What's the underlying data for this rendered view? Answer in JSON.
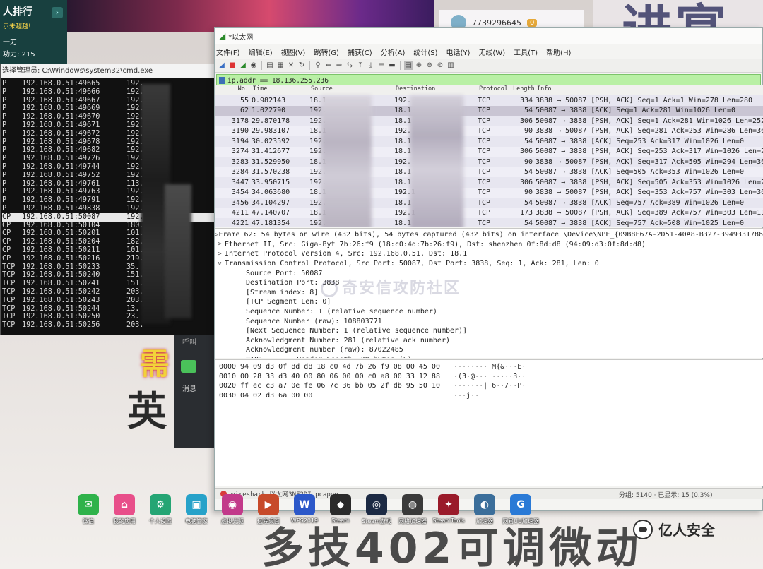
{
  "background": {
    "rank_panel": {
      "title": "人排行",
      "subtitle": "示未超越!",
      "name": "一刀",
      "score": "功力: 215"
    },
    "user_card": {
      "id": "7739296645",
      "level": "0"
    },
    "big_text_top": "进宴",
    "big_text_bottom": "多技402可调微动",
    "banner_chars": [
      "需",
      "英"
    ]
  },
  "side_chat": {
    "label_call": "呼叫",
    "label_message": "消息"
  },
  "cmd": {
    "title": "选择管理员: C:\\Windows\\system32\\cmd.exe",
    "rows": [
      {
        "proto": "P",
        "addr": "192.168.0.51:49665",
        "foreign": "192."
      },
      {
        "proto": "P",
        "addr": "192.168.0.51:49666",
        "foreign": "192."
      },
      {
        "proto": "P",
        "addr": "192.168.0.51:49667",
        "foreign": "192."
      },
      {
        "proto": "P",
        "addr": "192.168.0.51:49669",
        "foreign": "192."
      },
      {
        "proto": "P",
        "addr": "192.168.0.51:49670",
        "foreign": "192."
      },
      {
        "proto": "P",
        "addr": "192.168.0.51:49671",
        "foreign": "192."
      },
      {
        "proto": "P",
        "addr": "192.168.0.51:49672",
        "foreign": "192."
      },
      {
        "proto": "P",
        "addr": "192.168.0.51:49678",
        "foreign": "192."
      },
      {
        "proto": "P",
        "addr": "192.168.0.51:49682",
        "foreign": "192."
      },
      {
        "proto": "P",
        "addr": "192.168.0.51:49726",
        "foreign": "192."
      },
      {
        "proto": "P",
        "addr": "192.168.0.51:49744",
        "foreign": "192."
      },
      {
        "proto": "P",
        "addr": "192.168.0.51:49752",
        "foreign": "192."
      },
      {
        "proto": "P",
        "addr": "192.168.0.51:49761",
        "foreign": "113."
      },
      {
        "proto": "P",
        "addr": "192.168.0.51:49763",
        "foreign": "192."
      },
      {
        "proto": "P",
        "addr": "192.168.0.51:49791",
        "foreign": "192."
      },
      {
        "proto": "P",
        "addr": "192.168.0.51:49838",
        "foreign": "192."
      },
      {
        "proto": "CP",
        "addr": "192.168.0.51:50087",
        "foreign": "192."
      },
      {
        "proto": "CP",
        "addr": "192.168.0.51:50104",
        "foreign": "180."
      },
      {
        "proto": "CP",
        "addr": "192.168.0.51:50201",
        "foreign": "101."
      },
      {
        "proto": "CP",
        "addr": "192.168.0.51:50204",
        "foreign": "182."
      },
      {
        "proto": "CP",
        "addr": "192.168.0.51:50211",
        "foreign": "101."
      },
      {
        "proto": "CP",
        "addr": "192.168.0.51:50216",
        "foreign": "219."
      },
      {
        "proto": "TCP",
        "addr": "192.168.0.51:50233",
        "foreign": "35."
      },
      {
        "proto": "TCP",
        "addr": "192.168.0.51:50240",
        "foreign": "151."
      },
      {
        "proto": "TCP",
        "addr": "192.168.0.51:50241",
        "foreign": "151."
      },
      {
        "proto": "TCP",
        "addr": "192.168.0.51:50242",
        "foreign": "203."
      },
      {
        "proto": "TCP",
        "addr": "192.168.0.51:50243",
        "foreign": "203."
      },
      {
        "proto": "TCP",
        "addr": "192.168.0.51:50244",
        "foreign": "13."
      },
      {
        "proto": "TCP",
        "addr": "192.168.0.51:50250",
        "foreign": "23."
      },
      {
        "proto": "TCP",
        "addr": "192.168.0.51:50256",
        "foreign": "203."
      }
    ]
  },
  "wireshark": {
    "title": "*以太网",
    "menu": [
      "文件(F)",
      "编辑(E)",
      "视图(V)",
      "跳转(G)",
      "捕获(C)",
      "分析(A)",
      "统计(S)",
      "电话(Y)",
      "无线(W)",
      "工具(T)",
      "帮助(H)"
    ],
    "filter": "ip.addr == 18.136.255.236",
    "columns": [
      "No.",
      "Time",
      "Source",
      "Destination",
      "Protocol",
      "Length",
      "Info"
    ],
    "packets": [
      {
        "no": "55",
        "time": "0.982143",
        "src": "18.1",
        "dst": "192.",
        "proto": "TCP",
        "len": "334",
        "info": "3838 → 50087 [PSH, ACK] Seq=1 Ack=1 Win=278 Len=280"
      },
      {
        "no": "62",
        "time": "1.022790",
        "src": "192.",
        "dst": "18.1",
        "proto": "TCP",
        "len": "54",
        "info": "50087 → 3838 [ACK] Seq=1 Ack=281 Win=1026 Len=0"
      },
      {
        "no": "3178",
        "time": "29.870178",
        "src": "192.",
        "dst": "18.1",
        "proto": "TCP",
        "len": "306",
        "info": "50087 → 3838 [PSH, ACK] Seq=1 Ack=281 Win=1026 Len=252"
      },
      {
        "no": "3190",
        "time": "29.983107",
        "src": "18.1",
        "dst": "192.",
        "proto": "TCP",
        "len": "90",
        "info": "3838 → 50087 [PSH, ACK] Seq=281 Ack=253 Win=286 Len=36"
      },
      {
        "no": "3194",
        "time": "30.023592",
        "src": "192.",
        "dst": "18.1",
        "proto": "TCP",
        "len": "54",
        "info": "50087 → 3838 [ACK] Seq=253 Ack=317 Win=1026 Len=0"
      },
      {
        "no": "3274",
        "time": "31.412677",
        "src": "192.",
        "dst": "18.1",
        "proto": "TCP",
        "len": "306",
        "info": "50087 → 3838 [PSH, ACK] Seq=253 Ack=317 Win=1026 Len=252"
      },
      {
        "no": "3283",
        "time": "31.529950",
        "src": "18.1",
        "dst": "192.",
        "proto": "TCP",
        "len": "90",
        "info": "3838 → 50087 [PSH, ACK] Seq=317 Ack=505 Win=294 Len=36"
      },
      {
        "no": "3284",
        "time": "31.570238",
        "src": "192.",
        "dst": "18.1",
        "proto": "TCP",
        "len": "54",
        "info": "50087 → 3838 [ACK] Seq=505 Ack=353 Win=1026 Len=0"
      },
      {
        "no": "3447",
        "time": "33.950715",
        "src": "192.",
        "dst": "18.1",
        "proto": "TCP",
        "len": "306",
        "info": "50087 → 3838 [PSH, ACK] Seq=505 Ack=353 Win=1026 Len=252"
      },
      {
        "no": "3454",
        "time": "34.063680",
        "src": "18.1",
        "dst": "192.1",
        "proto": "TCP",
        "len": "90",
        "info": "3838 → 50087 [PSH, ACK] Seq=353 Ack=757 Win=303 Len=36"
      },
      {
        "no": "3456",
        "time": "34.104297",
        "src": "192.",
        "dst": "18.1",
        "proto": "TCP",
        "len": "54",
        "info": "50087 → 3838 [ACK] Seq=757 Ack=389 Win=1026 Len=0"
      },
      {
        "no": "4211",
        "time": "47.140707",
        "src": "18.1",
        "dst": "192.1",
        "proto": "TCP",
        "len": "173",
        "info": "3838 → 50087 [PSH, ACK] Seq=389 Ack=757 Win=303 Len=119"
      },
      {
        "no": "4221",
        "time": "47.181354",
        "src": "192.",
        "dst": "18.1",
        "proto": "TCP",
        "len": "54",
        "info": "50087 → 3838 [ACK] Seq=757 Ack=508 Win=1025 Len=0"
      }
    ],
    "details": [
      {
        "exp": ">",
        "indent": false,
        "text": "Frame 62: 54 bytes on wire (432 bits), 54 bytes captured (432 bits) on interface \\Device\\NPF_{09B8F67A-2D51-40A8-B327-394933178650}, i"
      },
      {
        "exp": ">",
        "indent": false,
        "text": "Ethernet II, Src: Giga-Byt_7b:26:f9 (18:c0:4d:7b:26:f9), Dst: shenzhen_0f:8d:d8 (94:09:d3:0f:8d:d8)"
      },
      {
        "exp": ">",
        "indent": false,
        "text": "Internet Protocol Version 4, Src: 192.168.0.51, Dst: 18.1"
      },
      {
        "exp": "v",
        "indent": false,
        "text": "Transmission Control Protocol, Src Port: 50087, Dst Port: 3838, Seq: 1, Ack: 281, Len: 0"
      },
      {
        "exp": "",
        "indent": true,
        "text": "Source Port: 50087"
      },
      {
        "exp": "",
        "indent": true,
        "text": "Destination Port: 3838"
      },
      {
        "exp": "",
        "indent": true,
        "text": "[Stream index: 8]"
      },
      {
        "exp": "",
        "indent": true,
        "text": "[TCP Segment Len: 0]"
      },
      {
        "exp": "",
        "indent": true,
        "text": "Sequence Number: 1    (relative sequence number)"
      },
      {
        "exp": "",
        "indent": true,
        "text": "Sequence Number (raw): 108803771"
      },
      {
        "exp": "",
        "indent": true,
        "text": "[Next Sequence Number: 1    (relative sequence number)]"
      },
      {
        "exp": "",
        "indent": true,
        "text": "Acknowledgment Number: 281    (relative ack number)"
      },
      {
        "exp": "",
        "indent": true,
        "text": "Acknowledgment number (raw): 87022485"
      },
      {
        "exp": "",
        "indent": true,
        "text": "0101 .... = Header Length: 20 bytes (5)"
      }
    ],
    "watermark": "奇安信攻防社区",
    "hex": [
      {
        "off": "0000",
        "bytes": "94 09 d3 0f 8d d8 18 c0  4d 7b 26 f9 08 00 45 00",
        "ascii": "········ M{&···E·"
      },
      {
        "off": "0010",
        "bytes": "00 28 33 d3 40 00 80 06  00 00 c0 a8 00 33 12 88",
        "ascii": "·(3·@··· ·····3··"
      },
      {
        "off": "0020",
        "bytes": "ff ec c3 a7 0e fe 06 7c  36 bb 05 2f db 95 50 10",
        "ascii": "·······| 6··/··P·"
      },
      {
        "off": "0030",
        "bytes": "04 02 d3 6a 00 00",
        "ascii": "···j··"
      }
    ],
    "status_file": "wireshark_以太网3NF2DI.pcapng",
    "status_right": "分组: 5140 · 已显示: 15 (0.3%)"
  },
  "dock": [
    {
      "label": "微信",
      "color": "#2fb24a",
      "glyph": "✉"
    },
    {
      "label": "我的应用",
      "color": "#e84f8a",
      "glyph": "⌂"
    },
    {
      "label": "个人设置",
      "color": "#25a574",
      "glyph": "⚙"
    },
    {
      "label": "电脑管家",
      "color": "#27a2c9",
      "glyph": "▣"
    },
    {
      "label": "虚拟光驱",
      "color": "#c23a8a",
      "glyph": "◉"
    },
    {
      "label": "远程桌面",
      "color": "#c74a2a",
      "glyph": "▶"
    },
    {
      "label": "WPS2019",
      "color": "#2c58c9",
      "glyph": "W"
    },
    {
      "label": "Steam",
      "color": "#2b2b2b",
      "glyph": "◆"
    },
    {
      "label": "Steam游戏",
      "color": "#1c2a44",
      "glyph": "◎"
    },
    {
      "label": "网络加速器",
      "color": "#3a3a3a",
      "glyph": "◍"
    },
    {
      "label": "SteamTools",
      "color": "#9a1b2a",
      "glyph": "✦"
    },
    {
      "label": "加速器",
      "color": "#3b6e9a",
      "glyph": "◐"
    },
    {
      "label": "网易UU加速器",
      "color": "#2a7ad6",
      "glyph": "G"
    }
  ],
  "site_logo": "亿人安全"
}
